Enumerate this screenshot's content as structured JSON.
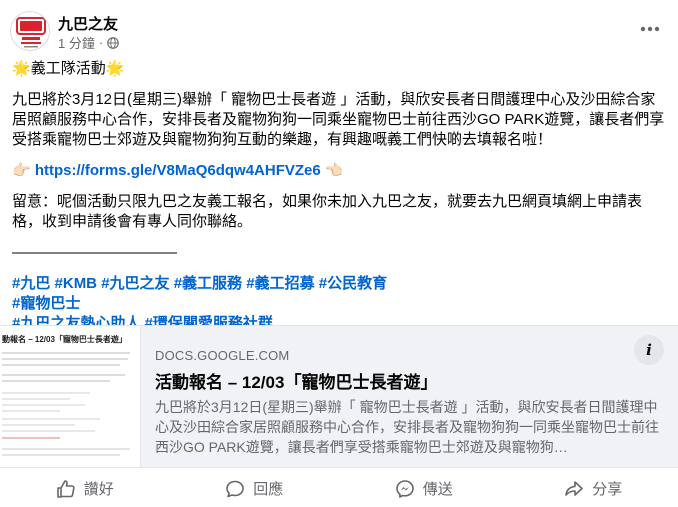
{
  "post": {
    "page_name": "九巴之友",
    "time": "1 分鐘",
    "heading_star_left": "🌟",
    "heading": "義工隊活動",
    "heading_star_right": "🌟",
    "body": "九巴將於3月12日(星期三)舉辦「 寵物巴士長者遊 」活動，與欣安長者日間護理中心及沙田綜合家居照顧服務中心合作，安排長者及寵物狗狗一同乘坐寵物巴士前往西沙GO PARK遊覽，讓長者們享受搭乘寵物巴士郊遊及與寵物狗狗互動的樂趣，有興趣嘅義工們快啲去填報名啦！",
    "link_emoji_left": "👉🏻",
    "link": "https://forms.gle/V8MaQ6dqw4AHFVZe6",
    "link_emoji_right": "👈🏻",
    "note": "留意：呢個活動只限九巴之友義工報名，如果你未加入九巴之友，就要去九巴網頁填網上申請表格，收到申請後會有專人同你聯絡。",
    "divider": "———————————",
    "hashtags_line1": [
      "#九巴",
      "#KMB",
      "#九巴之友",
      "#義工服務",
      "#義工招募",
      "#公民教育"
    ],
    "hashtags_line2": [
      "#寵物巴士"
    ],
    "hashtags_line3": [
      "#九巴之友熱心助人",
      "#環保關愛服務社群"
    ]
  },
  "card": {
    "thumb_title": "動報名 – 12/03「寵物巴士長者遊」",
    "domain": "DOCS.GOOGLE.COM",
    "title": "活動報名 – 12/03「寵物巴士長者遊」",
    "description": "九巴將於3月12日(星期三)舉辦「 寵物巴士長者遊 」活動，與欣安長者日間護理中心及沙田綜合家居照顧服務中心合作，安排長者及寵物狗狗一同乘坐寵物巴士前往西沙GO PARK遊覽，讓長者們享受搭乘寵物巴士郊遊及與寵物狗…",
    "info": "i"
  },
  "actions": {
    "like": "讚好",
    "comment": "回應",
    "send": "傳送",
    "share": "分享"
  },
  "colors": {
    "link": "#0064d1",
    "secondary_text": "#65676b",
    "card_bg": "#f0f2f5",
    "logo_red": "#d9232d"
  }
}
